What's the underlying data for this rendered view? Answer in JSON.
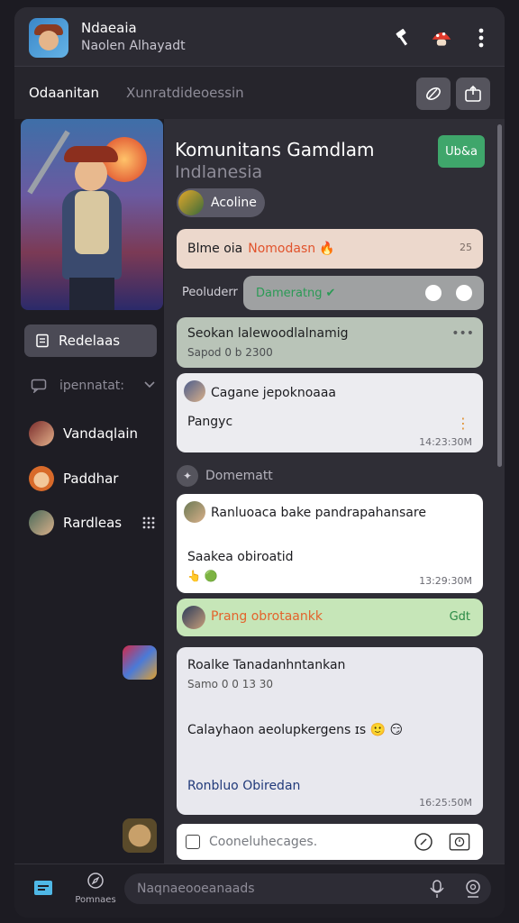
{
  "app": {
    "name": "Ndaeaia",
    "subtitle": "Naolen Alhayadt"
  },
  "topbar": {
    "icons": [
      "hammer-icon",
      "mushroom-avatar-icon",
      "more-vertical-icon"
    ]
  },
  "subbar": {
    "tab_primary": "Odaanitan",
    "tab_secondary": "Xunratdideoessin",
    "icons": [
      "feather-icon",
      "share-icon"
    ]
  },
  "sidebar": {
    "primary_button": "Redelaas",
    "section_label": "ipennatat:",
    "items": [
      {
        "label": "Vandaqlain",
        "avatar": "warrior-avatar"
      },
      {
        "label": "Paddhar",
        "avatar": "orange-avatar"
      },
      {
        "label": "Rardleas",
        "avatar": "knight-avatar"
      }
    ]
  },
  "channel": {
    "title": "Komunitans Gamdlam",
    "subtitle": "Indlanesia",
    "online_button": "Ub&a",
    "active_label": "Acoline"
  },
  "rows": {
    "r1_text": "Blme oia",
    "r1_hot": "Nomodasn",
    "r1_count": "25",
    "r2_label": "Peoluderr",
    "r2_pill": "Dameratng",
    "r3_title": "Seokan lalewoodlalnamig",
    "r3_sub": "Sapod 0 b 2300"
  },
  "messages": [
    {
      "name": "Cagane jepoknoaaa",
      "text": "Pangyc",
      "time": "14:23:30M"
    },
    {
      "name": "Ranluoaca bake pandrapahansare",
      "text": "Saakea obiroatid",
      "reacts": "👆 🟢",
      "time": "13:29:30M"
    },
    {
      "name": "Prang obrotaankk",
      "end": "Gdt"
    },
    {
      "name": "Roalke Tanadanhntankan",
      "sub": "Samo 0 0 13 30",
      "text": "Calayhaon aeolupkergens ɪs 🙂 😏",
      "text2": "Ronbluo Obiredan",
      "time": "16:25:50M"
    }
  ],
  "separator": {
    "label": "Domematt"
  },
  "composer": {
    "placeholder": "Cooneluhecages."
  },
  "bottombar": {
    "rem_label": "Pomnaes",
    "search_placeholder": "Naqnaeooeanaads"
  }
}
